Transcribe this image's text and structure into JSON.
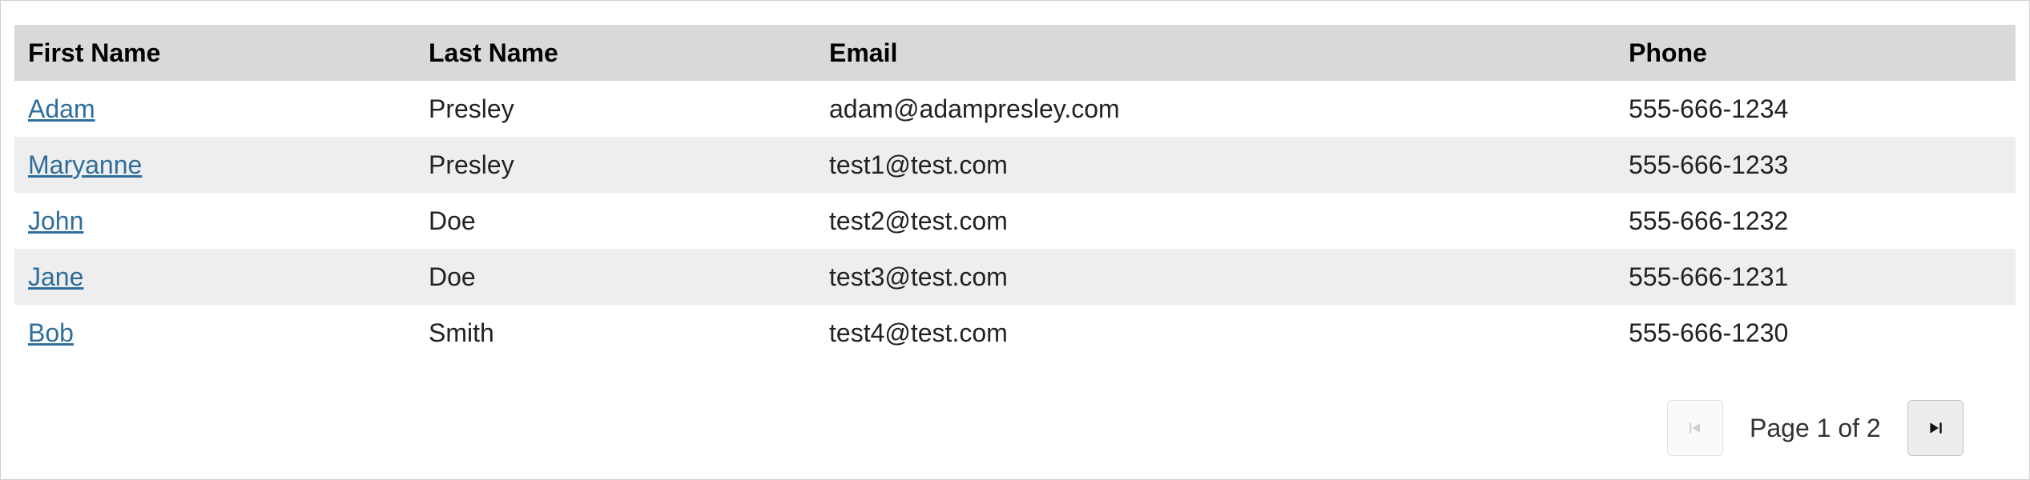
{
  "table": {
    "headers": {
      "first_name": "First Name",
      "last_name": "Last Name",
      "email": "Email",
      "phone": "Phone"
    },
    "rows": [
      {
        "first_name": "Adam",
        "last_name": "Presley",
        "email": "adam@adampresley.com",
        "phone": "555-666-1234"
      },
      {
        "first_name": "Maryanne",
        "last_name": "Presley",
        "email": "test1@test.com",
        "phone": "555-666-1233"
      },
      {
        "first_name": "John",
        "last_name": "Doe",
        "email": "test2@test.com",
        "phone": "555-666-1232"
      },
      {
        "first_name": "Jane",
        "last_name": "Doe",
        "email": "test3@test.com",
        "phone": "555-666-1231"
      },
      {
        "first_name": "Bob",
        "last_name": "Smith",
        "email": "test4@test.com",
        "phone": "555-666-1230"
      }
    ]
  },
  "pagination": {
    "label": "Page 1 of 2",
    "first_icon": "skip-to-first-icon",
    "last_icon": "skip-to-last-icon",
    "first_enabled": false,
    "last_enabled": true
  },
  "colors": {
    "header_bg": "#d9d9d9",
    "alt_row_bg": "#eeeeee",
    "link": "#2f6e9c"
  }
}
